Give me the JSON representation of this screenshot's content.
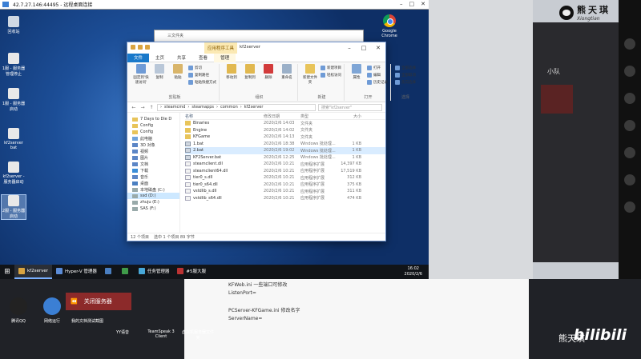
{
  "rdp": {
    "title": "42.7.27.146:44495 - 远程桌面连接"
  },
  "desktop_icons": [
    {
      "label": "回收站"
    },
    {
      "label": "1服 - 服务器管理停止"
    },
    {
      "label": "1服 - 服务器启动"
    },
    {
      "label": "kf2server bat"
    },
    {
      "label": "kf2server - 服务器启动"
    },
    {
      "label": "2服 - 服务器启动"
    }
  ],
  "chrome_icon": {
    "label": "Google Chrome"
  },
  "bg_window": {
    "title": "三文件夹"
  },
  "explorer": {
    "ctx_tab": "应用程序工具",
    "title": "kf2server",
    "ribbon_tabs": [
      "文件",
      "主页",
      "共享",
      "查看",
      "管理"
    ],
    "ribbon": {
      "clipboard": {
        "label": "剪贴板",
        "pin": "固定到'快速访问'",
        "copy": "复制",
        "paste": "粘贴",
        "cut": "剪切",
        "copy_path": "复制路径",
        "paste_shortcut": "粘贴快捷方式"
      },
      "organize": {
        "label": "组织",
        "move": "移动到",
        "copy": "复制到",
        "delete": "删除",
        "rename": "重命名"
      },
      "new": {
        "label": "新建",
        "folder": "新建文件夹",
        "item": "新建项目",
        "easy": "轻松访问"
      },
      "open": {
        "label": "打开",
        "props": "属性",
        "open": "打开",
        "edit": "编辑",
        "history": "历史记录"
      },
      "select": {
        "label": "选择",
        "all": "全部选择",
        "none": "全部取消",
        "invert": "反向选择"
      }
    },
    "address": [
      "steamcmd",
      "steamapps",
      "common",
      "kf2server"
    ],
    "search_placeholder": "搜索\"kf2server\"",
    "nav": [
      {
        "label": "7 Days to Die D"
      },
      {
        "label": "Config"
      },
      {
        "label": "Config"
      },
      {
        "label": "此电脑"
      },
      {
        "label": "3D 对象"
      },
      {
        "label": "视频"
      },
      {
        "label": "图片"
      },
      {
        "label": "文档"
      },
      {
        "label": "下载"
      },
      {
        "label": "音乐"
      },
      {
        "label": "桌面"
      },
      {
        "label": "本地磁盘 (C:)"
      },
      {
        "label": "ssd (D:)"
      },
      {
        "label": "zhuju (E:)"
      },
      {
        "label": "SAS (F:)"
      }
    ],
    "columns": {
      "name": "名称",
      "date": "修改日期",
      "type": "类型",
      "size": "大小"
    },
    "files": [
      {
        "name": "Binaries",
        "date": "2020/2/6 14:03",
        "type": "文件夹",
        "size": "",
        "kind": "folder"
      },
      {
        "name": "Engine",
        "date": "2020/2/6 14:02",
        "type": "文件夹",
        "size": "",
        "kind": "folder"
      },
      {
        "name": "KFGame",
        "date": "2020/2/6 14:13",
        "type": "文件夹",
        "size": "",
        "kind": "folder"
      },
      {
        "name": "1.bat",
        "date": "2020/2/6 18:38",
        "type": "Windows 批处理...",
        "size": "1 KB",
        "kind": "bat"
      },
      {
        "name": "2.bat",
        "date": "2020/2/6 19:02",
        "type": "Windows 批处理...",
        "size": "1 KB",
        "kind": "bat"
      },
      {
        "name": "KF2Server.bat",
        "date": "2020/2/6 12:25",
        "type": "Windows 批处理...",
        "size": "1 KB",
        "kind": "bat"
      },
      {
        "name": "steamclient.dll",
        "date": "2020/2/6 10:21",
        "type": "应用程序扩展",
        "size": "14,397 KB",
        "kind": "dll"
      },
      {
        "name": "steamclient64.dll",
        "date": "2020/2/6 10:21",
        "type": "应用程序扩展",
        "size": "17,519 KB",
        "kind": "dll"
      },
      {
        "name": "tier0_s.dll",
        "date": "2020/2/6 10:21",
        "type": "应用程序扩展",
        "size": "312 KB",
        "kind": "dll"
      },
      {
        "name": "tier0_s64.dll",
        "date": "2020/2/6 10:21",
        "type": "应用程序扩展",
        "size": "375 KB",
        "kind": "dll"
      },
      {
        "name": "vstdlib_s.dll",
        "date": "2020/2/6 10:21",
        "type": "应用程序扩展",
        "size": "311 KB",
        "kind": "dll"
      },
      {
        "name": "vstdlib_s64.dll",
        "date": "2020/2/6 10:21",
        "type": "应用程序扩展",
        "size": "474 KB",
        "kind": "dll"
      }
    ],
    "status": {
      "count": "12 个项目",
      "selected": "选中 1 个项目 89 字节"
    }
  },
  "taskbar": {
    "items": [
      {
        "label": "kf2server",
        "active": true
      },
      {
        "label": "Hyper-V 管理器",
        "active": false
      },
      {
        "label": "",
        "active": false
      },
      {
        "label": "",
        "active": false
      },
      {
        "label": "任务管理器",
        "active": false
      },
      {
        "label": "#5服大服",
        "active": false
      }
    ],
    "time": "16:02",
    "date": "2020/2/6"
  },
  "host": {
    "logo": "熊天琪",
    "logo_sub": "Xiongtian",
    "panel_label": "小队",
    "bottom_lines": [
      "KFWeb.ini 一些端口可修改",
      "ListenPort=",
      "PCServer-KFGame.ini 修改名字",
      "ServerName="
    ],
    "red_button": "关闭服务器",
    "bottom_icons": [
      {
        "label": "腾讯QQ"
      },
      {
        "label": "网络运行"
      },
      {
        "label": "我的文档测试截图"
      },
      {
        "label": "YY语音"
      },
      {
        "label": "TeamSpeak 3 Client"
      },
      {
        "label": "虚拟机服务器文件夹"
      }
    ],
    "watermark": "熊天琪",
    "bilibili": "bilibili"
  }
}
